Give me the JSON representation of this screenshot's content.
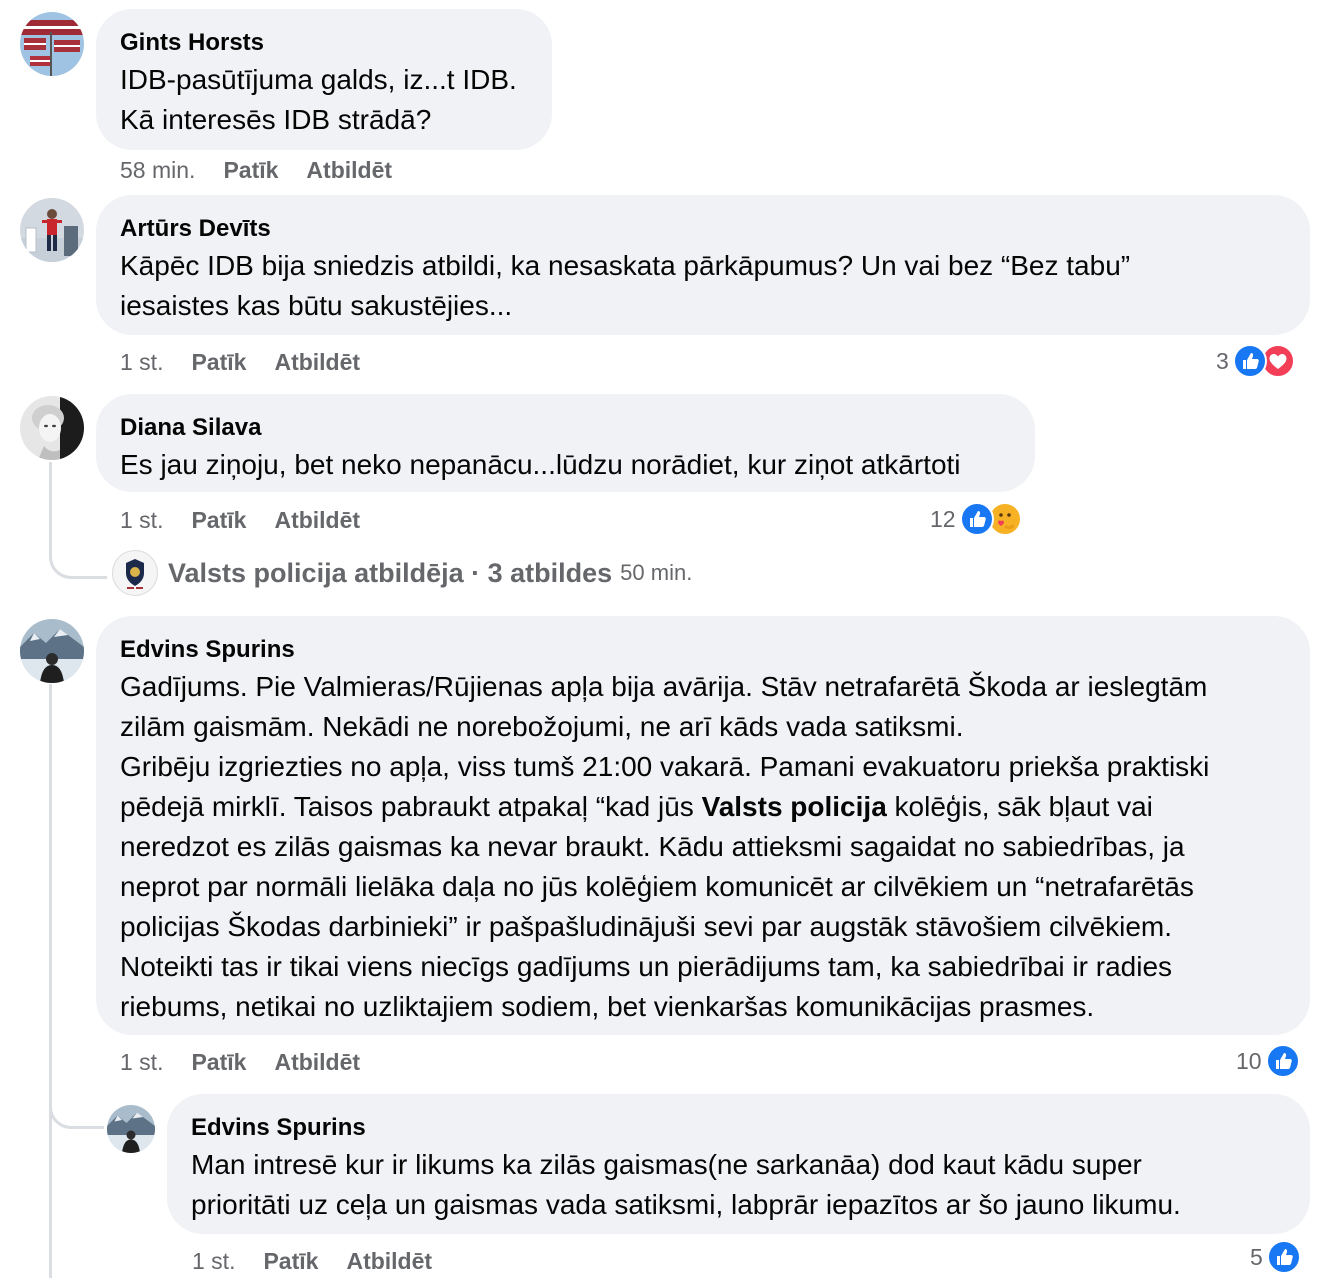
{
  "labels": {
    "like": "Patīk",
    "reply": "Atbildēt"
  },
  "comments": [
    {
      "author": "Gints Horsts",
      "lines": [
        "IDB-pasūtījuma galds, iz...t IDB.",
        "Kā interesēs IDB strādā?"
      ],
      "time": "58 min."
    },
    {
      "author": "Artūrs Devīts",
      "lines": [
        "Kāpēc IDB bija sniedzis atbildi, ka nesaskata pārkāpumus? Un vai bez “Bez tabu”",
        "iesaistes kas būtu sakustējies..."
      ],
      "time": "1 st.",
      "reaction_count": "3",
      "reaction_icons": [
        "like-icon",
        "love-icon"
      ]
    },
    {
      "author": "Diana Silava",
      "lines": [
        "Es jau ziņoju, bet neko nepanācu...lūdzu norādiet, kur ziņot atkārtoti"
      ],
      "time": "1 st.",
      "reaction_count": "12",
      "reaction_icons": [
        "like-icon",
        "care-icon"
      ],
      "replies": {
        "label": "Valsts policija atbildēja",
        "separator": " · ",
        "count_label": "3 atbildes",
        "time": "50 min."
      }
    },
    {
      "author": "Edvins Spurins",
      "lines": [
        "Gadījums. Pie Valmieras/Rūjienas apļa bija avārija. Stāv netrafarētā Škoda ar ieslegtām",
        "zilām gaismām. Nekādi ne norebožojumi, ne arī kāds vada satiksmi.",
        "Gribēju izgriezties no apļa, viss tumš 21:00 vakarā. Pamani evakuatoru priekša praktiski",
        "pēdejā mirklī. Taisos pabraukt atpakaļ “kad jūs ",
        "Valsts policija",
        " kolēģis, sāk bļaut vai",
        "neredzot es zilās gaismas ka nevar braukt. Kādu attieksmi sagaidat no sabiedrības, ja",
        "neprot par normāli lielāka daļa no jūs kolēģiem komunicēt ar cilvēkiem un “netrafarētās",
        "policijas Škodas darbinieki” ir pašpašludinājuši sevi par augstāk stāvošiem cilvēkiem.",
        "Noteikti tas ir tikai viens niecīgs gadījums un pierādijums tam, ka sabiedrībai ir radies",
        "riebums, netikai no uzliktajiem sodiem, bet vienkaršas komunikācijas prasmes."
      ],
      "time": "1 st.",
      "reaction_count": "10",
      "reaction_icons": [
        "like-icon"
      ]
    },
    {
      "author": "Edvins Spurins",
      "lines": [
        "Man intresē kur ir likums ka zilās gaismas(ne sarkanāa) dod kaut kādu super",
        "prioritāti uz ceļa un gaismas vada satiksmi, labprār iepazītos ar šo jauno likumu."
      ],
      "time": "1 st.",
      "reaction_count": "5",
      "reaction_icons": [
        "like-icon"
      ]
    }
  ],
  "colors": {
    "bubble": "#f0f2f5",
    "like": "#1877f2",
    "love": "#f33e58",
    "care": "#f7b125",
    "meta": "#65676b"
  }
}
